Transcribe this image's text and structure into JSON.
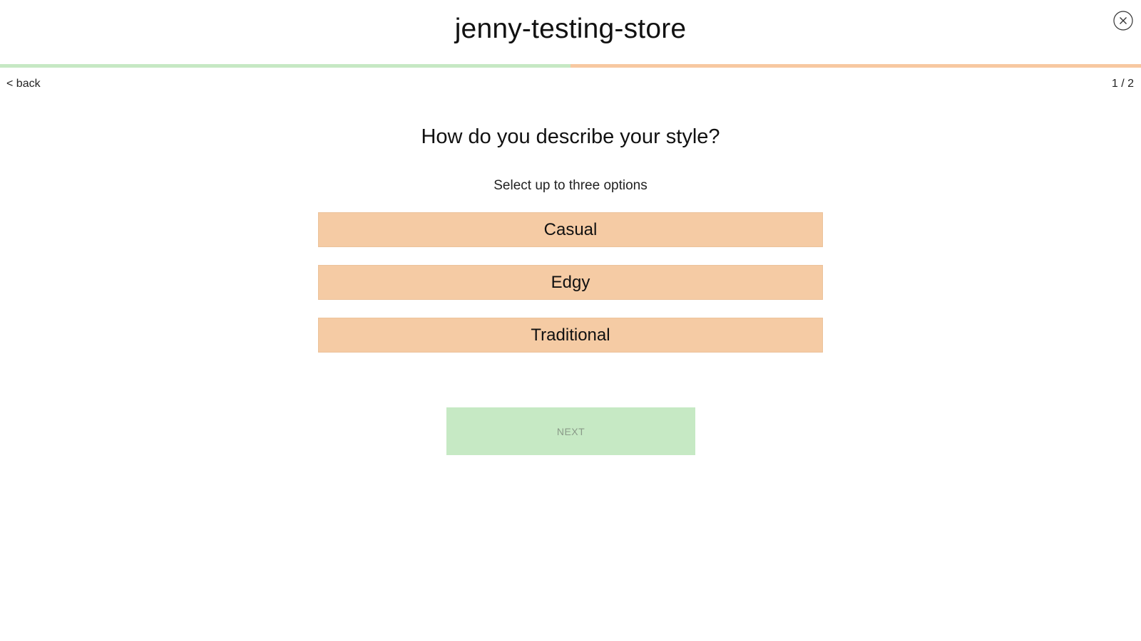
{
  "header": {
    "store_name": "jenny-testing-store",
    "close_icon": "close-circle-icon"
  },
  "progress": {
    "fraction": 0.5,
    "complete_color": "#c6e8c4",
    "remaining_color": "#f7c8a1"
  },
  "nav": {
    "back_label": "< back",
    "step_counter": "1 / 2"
  },
  "quiz": {
    "question": "How do you describe your style?",
    "hint": "Select up to three options",
    "options": [
      {
        "label": "Casual"
      },
      {
        "label": "Edgy"
      },
      {
        "label": "Traditional"
      }
    ],
    "next_label": "NEXT"
  },
  "colors": {
    "option_bg": "#f5cba4",
    "next_bg": "#c6e9c4"
  }
}
